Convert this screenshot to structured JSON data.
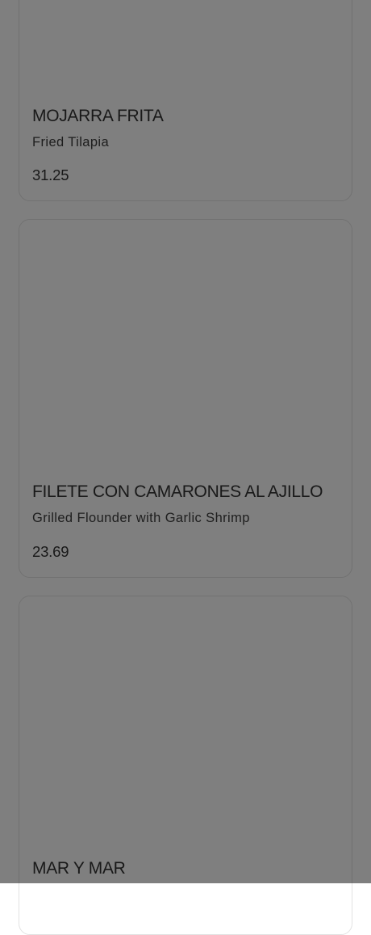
{
  "menu": {
    "items": [
      {
        "name": "MOJARRA FRITA",
        "description": "Fried Tilapia",
        "price": "31.25"
      },
      {
        "name": "FILETE CON CAMARONES AL AJILLO",
        "description": "Grilled Flounder with Garlic Shrimp",
        "price": "23.69"
      },
      {
        "name": "MAR Y MAR"
      }
    ]
  },
  "overlay": {
    "color": "#000000",
    "opacity": 0.5
  }
}
